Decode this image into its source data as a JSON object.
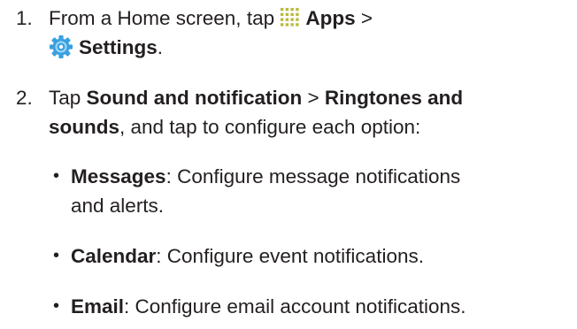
{
  "steps": [
    {
      "number": "1.",
      "text_before": "From a Home screen, tap ",
      "apps_label": "Apps",
      "separator": " >",
      "settings_label": "Settings",
      "end": "."
    },
    {
      "number": "2.",
      "text_before": "Tap ",
      "sound_label": "Sound and notification",
      "separator": " > ",
      "ringtones_label": "Ringtones and",
      "ringtones_label_2": "sounds",
      "text_after": ", and tap to configure each option:"
    }
  ],
  "options": [
    {
      "bullet": "•",
      "label": "Messages",
      "desc_line1": ": Configure message notifications",
      "desc_line2": "and alerts."
    },
    {
      "bullet": "•",
      "label": "Calendar",
      "desc_line1": ": Configure event notifications."
    },
    {
      "bullet": "•",
      "label": "Email",
      "desc_line1": ": Configure email account notifications."
    }
  ],
  "icons": {
    "apps": "apps-grid-icon",
    "settings": "settings-gear-icon",
    "apps_color": "#b9ba3d",
    "settings_color": "#3aa0e0"
  }
}
